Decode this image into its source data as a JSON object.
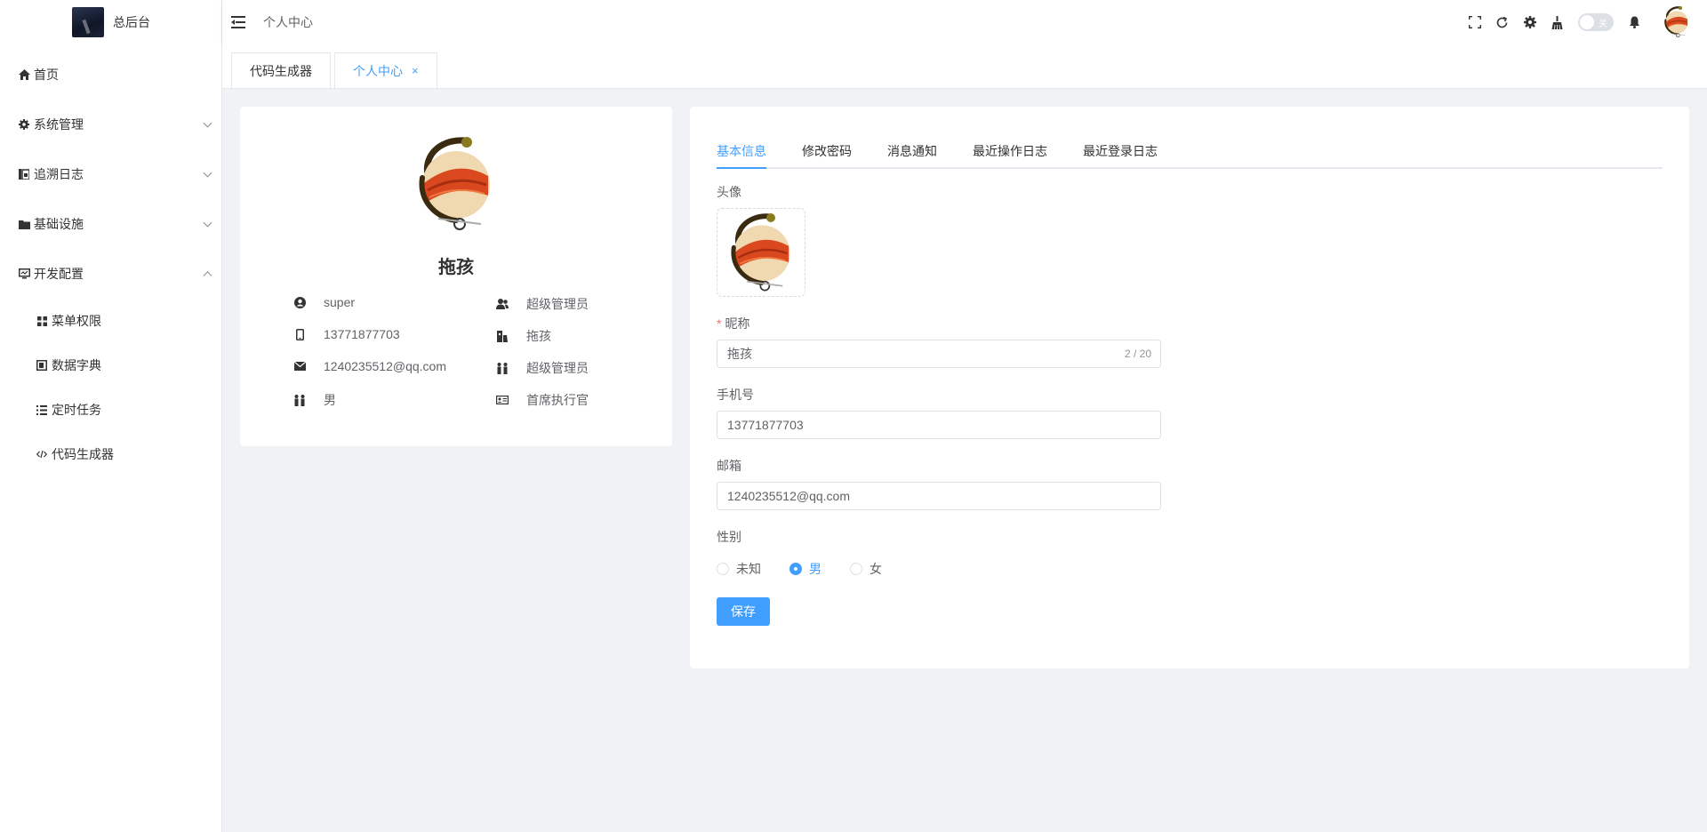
{
  "app": {
    "title": "总后台"
  },
  "sidebar": {
    "items": [
      {
        "label": "首页",
        "icon": "home-icon"
      },
      {
        "label": "系统管理",
        "icon": "gear-icon"
      },
      {
        "label": "追溯日志",
        "icon": "log-icon"
      },
      {
        "label": "基础设施",
        "icon": "folder-icon"
      },
      {
        "label": "开发配置",
        "icon": "monitor-icon"
      }
    ],
    "subitems": [
      {
        "label": "菜单权限",
        "icon": "grid-icon"
      },
      {
        "label": "数据字典",
        "icon": "dictionary-icon"
      },
      {
        "label": "定时任务",
        "icon": "list-icon"
      },
      {
        "label": "代码生成器",
        "icon": "code-icon"
      }
    ]
  },
  "header": {
    "breadcrumb": "个人中心",
    "toggle_label": "关"
  },
  "tags": {
    "items": [
      {
        "label": "代码生成器",
        "active": false
      },
      {
        "label": "个人中心",
        "active": true
      }
    ],
    "close": "×"
  },
  "profile": {
    "name": "拖孩",
    "username": "super",
    "role": "超级管理员",
    "phone": "13771877703",
    "nickname": "拖孩",
    "email": "1240235512@qq.com",
    "post": "超级管理员",
    "gender": "男",
    "title": "首席执行官"
  },
  "tabs": {
    "items": [
      "基本信息",
      "修改密码",
      "消息通知",
      "最近操作日志",
      "最近登录日志"
    ],
    "active_index": 0
  },
  "form": {
    "avatar_label": "头像",
    "nickname_label": "昵称",
    "nickname_value": "拖孩",
    "nickname_count": "2 / 20",
    "phone_label": "手机号",
    "phone_value": "13771877703",
    "email_label": "邮箱",
    "email_value": "1240235512@qq.com",
    "gender_label": "性别",
    "gender_options": [
      "未知",
      "男",
      "女"
    ],
    "gender_selected": "男",
    "save_label": "保存"
  },
  "colors": {
    "accent": "#409eff",
    "required": "#f56c6c",
    "page_bg": "#f0f2f5"
  }
}
